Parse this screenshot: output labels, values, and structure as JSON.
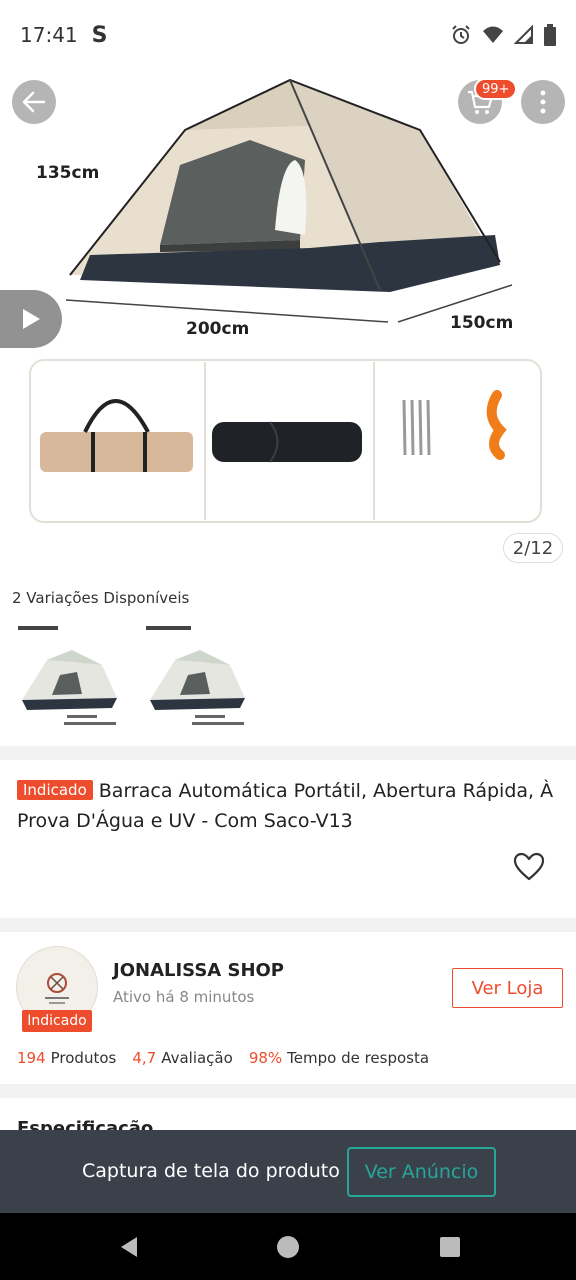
{
  "status_bar": {
    "time": "17:41",
    "carrier_icon_text": "S",
    "icons": [
      "alarm-icon",
      "wifi-icon",
      "signal-icon",
      "battery-icon"
    ]
  },
  "header": {
    "cart_badge": "99+"
  },
  "gallery": {
    "dimensions": {
      "height": "135cm",
      "length": "200cm",
      "width": "150cm"
    },
    "counter": "2/12"
  },
  "variations": {
    "title": "2 Variações Disponíveis"
  },
  "product": {
    "tag": "Indicado",
    "title": "Barraca Automática Portátil, Abertura Rápida, À Prova D'Água e UV - Com Saco-V13"
  },
  "shop": {
    "name": "JONALISSA SHOP",
    "active_status": "Ativo há 8 minutos",
    "badge": "Indicado",
    "visit_label": "Ver Loja",
    "stats": [
      {
        "value": "194",
        "label": "Produtos"
      },
      {
        "value": "4,7",
        "label": "Avaliação"
      },
      {
        "value": "98%",
        "label": "Tempo de resposta"
      }
    ]
  },
  "spec_peek": "Especificação",
  "banner": {
    "text": "Captura de tela do produto",
    "button_label": "Ver Anúncio"
  },
  "colors": {
    "accent": "#ee4d2d",
    "banner_bg": "#3a414b",
    "banner_button": "#26a69a"
  }
}
